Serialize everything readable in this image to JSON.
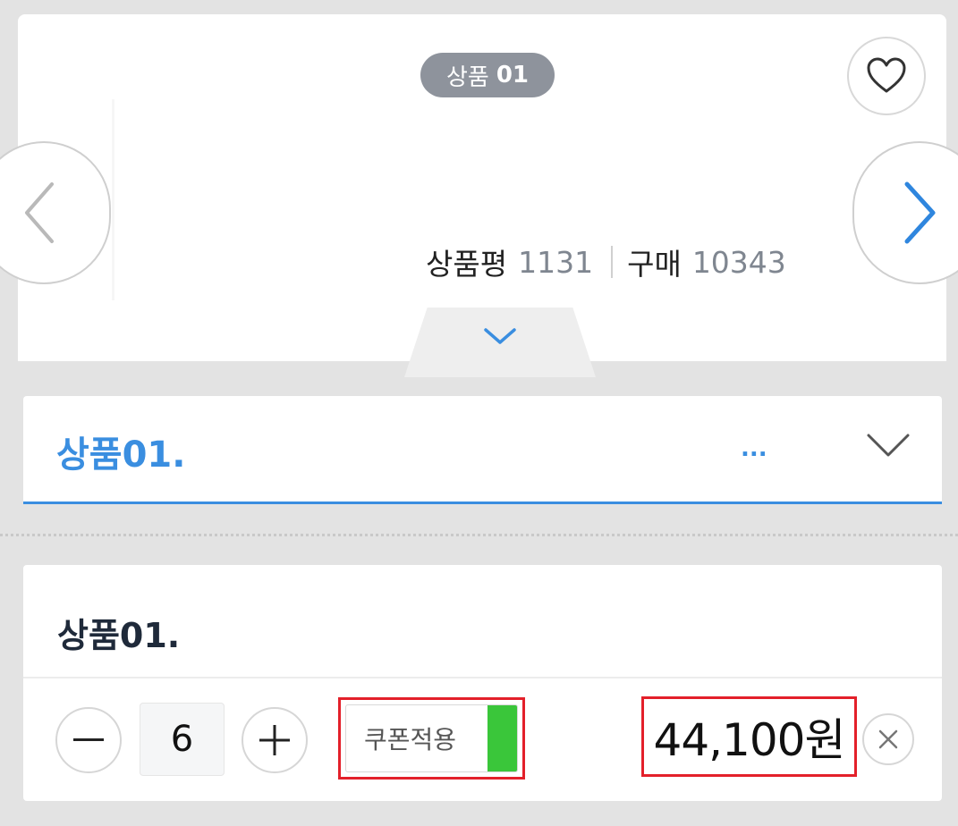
{
  "product": {
    "pill_prefix": "상품",
    "pill_number": "01",
    "review_label": "상품평",
    "review_count": "1131",
    "purchase_label": "구매",
    "purchase_count": "10343"
  },
  "icons": {
    "wishlist": "heart-icon",
    "prev": "chevron-left-icon",
    "next": "chevron-right-icon",
    "expand": "chevron-down-icon",
    "select": "chevron-down-icon",
    "minus": "minus-icon",
    "plus": "plus-icon",
    "remove": "close-icon"
  },
  "option_select": {
    "selected": "상품01.",
    "ellipsis": "..."
  },
  "selected_item": {
    "title": "상품01.",
    "quantity": "6",
    "coupon_label": "쿠폰적용",
    "coupon_enabled": true,
    "price": "44,100원"
  },
  "colors": {
    "accent": "#3a8ee0",
    "pill_bg": "#8e939c",
    "toggle_on": "#3ac63a",
    "highlight_box": "#e3202a"
  }
}
